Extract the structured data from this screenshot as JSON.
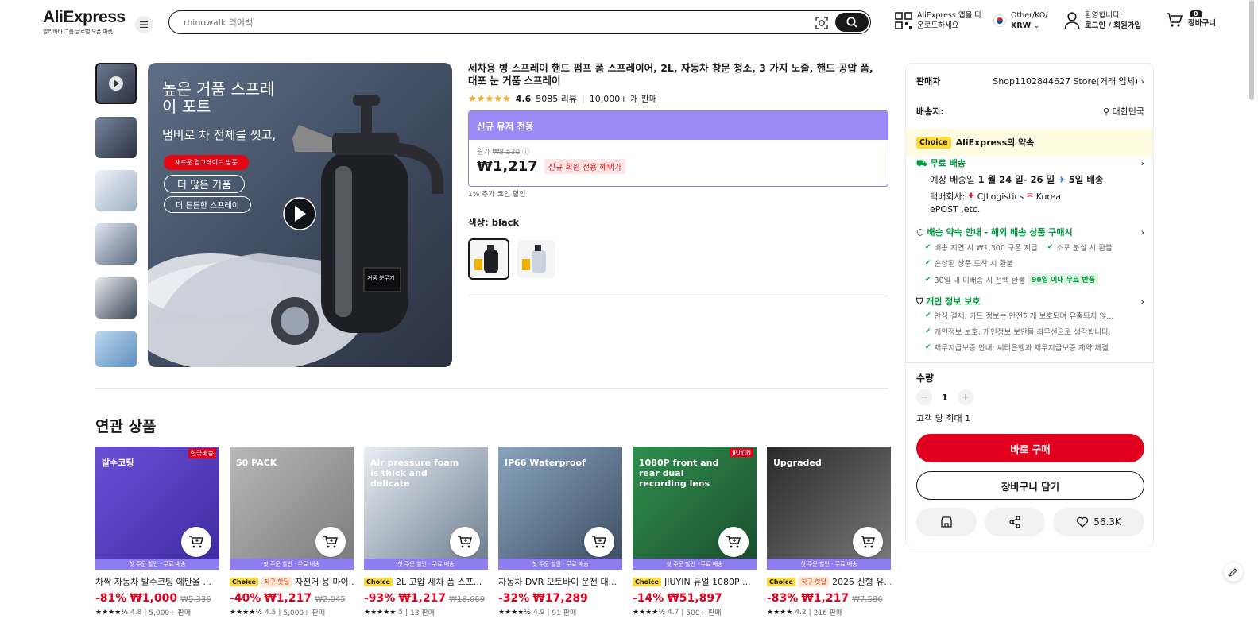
{
  "header": {
    "logo": "AliExpress",
    "logo_sub": "알리바바 그룹 글로벌 오픈 마켓",
    "search_placeholder": "rhinowalk 리어백",
    "app_line1": "AliExpress 앱을 다",
    "app_line2": "운로드하세요",
    "region_line1": "Other/KO/",
    "region_line2": "KRW",
    "account_line1": "환영합니다!",
    "account_line2": "로그인 / 회원가입",
    "cart_label": "장바구니",
    "cart_count": "0"
  },
  "gallery": {
    "overlay_title_1": "높은 거품 스프레",
    "overlay_title_2": "이 포트",
    "overlay_sub": "냄비로 차 전체를 씻고,",
    "badge_red": "새로운 업그레이드 방풍",
    "pill_1": "더 많은 거품",
    "pill_2": "더 튼튼한 스프레이",
    "bottle_label": "거품 분무기"
  },
  "product": {
    "title": "세차용 병 스프레이 핸드 펌프 폼 스프레이어, 2L, 자동차 창문 청소, 3 가지 노즐, 핸드 공압 폼, 대포 눈 거품 스프레이",
    "stars": "★★★★★",
    "rating": "4.6",
    "reviews": "5085 리뷰",
    "sold": "10,000+ 개 판매",
    "promo_header": "신규 유저 전용",
    "orig_label": "원가",
    "orig_price": "₩8,530",
    "price": "₩1,217",
    "deal_tag": "신규 회원 전용 혜택가",
    "coin": "1% 추가 코인 할인",
    "color_label": "색상: black"
  },
  "panel": {
    "seller_label": "판매자",
    "seller_value": "Shop1102844627 Store(거래 업체)",
    "ship_to_label": "배송지:",
    "ship_to_value": "대한민국",
    "choice_tag": "Choice",
    "choice_text": "AliExpress의 약속",
    "free_ship": "무료 배송",
    "eta_prefix": "예상 배송일",
    "eta_range": "1 월 24 일- 26 일",
    "eta_days": "5일 배송",
    "carrier_line": "택배회사:",
    "carrier_1": "CJLogistics",
    "carrier_2": "Korea",
    "carrier_3": "ePOST ,etc.",
    "promise_title": "배송 약속 안내 - 해외 배송 상품 구매시",
    "promise_1": "배송 지연 시 ₩1,300 쿠폰 지급",
    "promise_2": "소포 분실 시 환불",
    "promise_3": "손상된 상품 도착 시 환불",
    "promise_4": "30일 내 미배송 시 전액 환불",
    "promise_tag": "90일 이내 무료 반품",
    "privacy_title": "개인 정보 보호",
    "privacy_1": "안심 결제: 카드 정보는 안전하게 보호되며 유출되지 않...",
    "privacy_2": "개인정보 보호: 개인정보 보안을 최우선으로 생각합니다.",
    "privacy_3": "채무지급보증 안내: 씨티은행과 채무지급보증 계약 체결",
    "qty_label": "수량",
    "qty_value": "1",
    "qty_limit": "고객 당 최대 1",
    "buy_now": "바로 구매",
    "add_to_cart": "장바구니 담기",
    "wish_count": "56.3K"
  },
  "related": {
    "title": "연관 상품",
    "band_text": "첫 주문 할인 · 무료 배송",
    "cards": [
      {
        "name": "차싹 자동차 발수코팅 에탄올 ...",
        "choice": "",
        "tag2": "",
        "discount": "-81%",
        "price": "₩1,000",
        "orig": "₩5,336",
        "stars": "★★★★½",
        "rating": "4.8",
        "sold": "5,000+ 판매",
        "img_text": "발수코팅",
        "corner": "한국배송"
      },
      {
        "name": "자전거 용 마이...",
        "choice": "Choice",
        "tag2": "직구 핫딜",
        "discount": "-40%",
        "price": "₩1,217",
        "orig": "₩2,045",
        "stars": "★★★★½",
        "rating": "4.5",
        "sold": "5,000+ 판매",
        "img_text": "50 PACK",
        "corner": ""
      },
      {
        "name": "2L 고압 세차 폼 스프...",
        "choice": "Choice",
        "tag2": "",
        "discount": "-93%",
        "price": "₩1,217",
        "orig": "₩18,669",
        "stars": "★★★★★",
        "rating": "5",
        "sold": "13 판매",
        "img_text": "Air pressure foam is thick and delicate",
        "corner": ""
      },
      {
        "name": "자동차 DVR 오토바이 운전 대...",
        "choice": "",
        "tag2": "",
        "discount": "-32%",
        "price": "₩17,289",
        "orig": "",
        "stars": "★★★★½",
        "rating": "4.9",
        "sold": "91 판매",
        "img_text": "IP66 Waterproof",
        "corner": ""
      },
      {
        "name": "JIUYIN 듀얼 1080P ...",
        "choice": "Choice",
        "tag2": "",
        "discount": "-14%",
        "price": "₩51,897",
        "orig": "",
        "stars": "★★★★½",
        "rating": "4.7",
        "sold": "500+ 판매",
        "img_text": "1080P front and rear dual recording lens",
        "corner": "JIUYIN"
      },
      {
        "name": "2025 신형 유...",
        "choice": "Choice",
        "tag2": "직구 핫딜",
        "discount": "-83%",
        "price": "₩1,217",
        "orig": "₩7,586",
        "stars": "★★★★",
        "rating": "4.2",
        "sold": "216 판매",
        "img_text": "Upgraded",
        "corner": ""
      }
    ]
  },
  "colors": {
    "accent_red": "#e1001e",
    "promo_purple": "#9b8af5",
    "choice_yellow": "#fddb3a",
    "green": "#009a3e"
  }
}
